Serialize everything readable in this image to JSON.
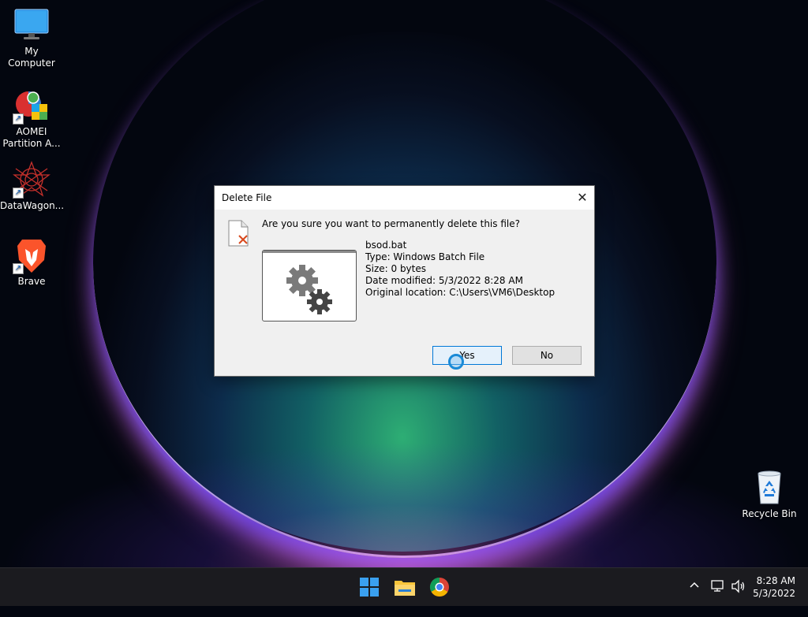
{
  "desktop": {
    "icons": [
      {
        "label": "My Computer",
        "icon": "monitor-icon"
      },
      {
        "label": "AOMEI\nPartition A...",
        "icon": "aomei-icon"
      },
      {
        "label": "DataWagon...",
        "icon": "datawagon-icon"
      },
      {
        "label": "Brave",
        "icon": "brave-lion-icon"
      },
      {
        "label": "Recycle Bin",
        "icon": "recycle-bin-icon"
      }
    ]
  },
  "dialog": {
    "title": "Delete File",
    "close": "✕",
    "question": "Are you sure you want to permanently delete this file?",
    "file": {
      "name": "bsod.bat",
      "type": "Type: Windows Batch File",
      "size": "Size: 0 bytes",
      "modified": "Date modified: 5/3/2022 8:28 AM",
      "location": "Original location: C:\\Users\\VM6\\Desktop"
    },
    "buttons": {
      "yes": "Yes",
      "no": "No"
    }
  },
  "taskbar": {
    "apps": [
      "windows-start-icon",
      "file-explorer-icon",
      "chrome-icon"
    ],
    "tray": {
      "chevron": "^",
      "time": "8:28 AM",
      "date": "5/3/2022"
    }
  },
  "colors": {
    "accent": "#0078d7",
    "taskbar": "#1b1b1f",
    "dialog_bg": "#f0f0f0"
  }
}
